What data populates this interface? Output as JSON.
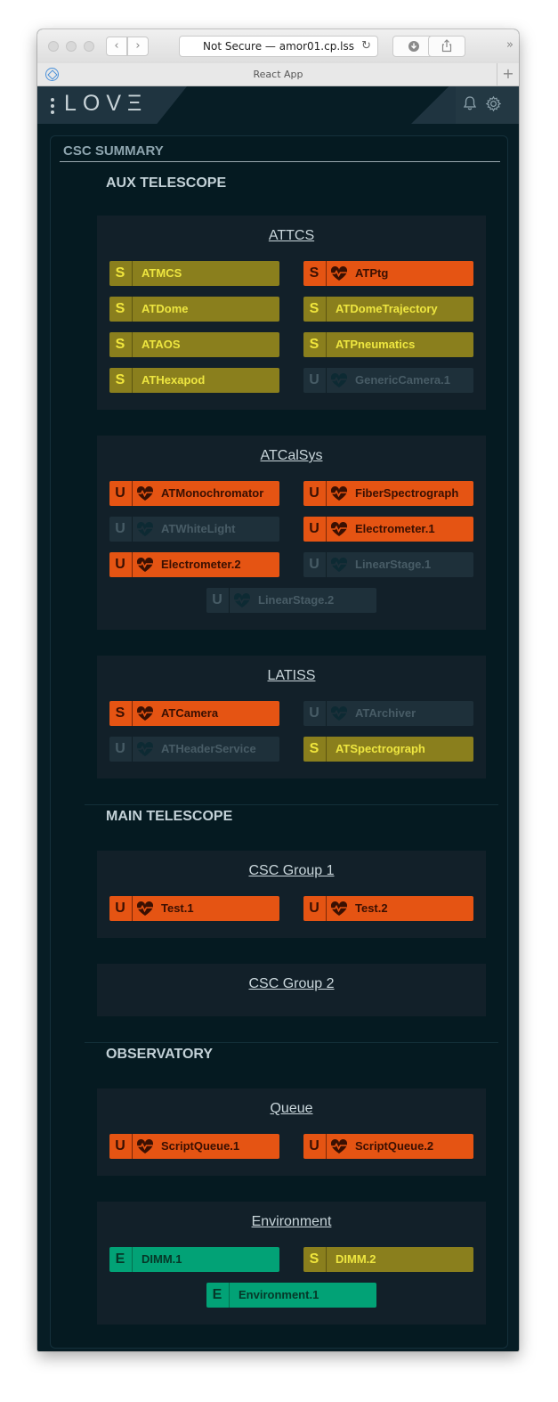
{
  "browser": {
    "address": "Not Secure — amor01.cp.lss",
    "tab_title": "React App",
    "back": "‹",
    "forward": "›",
    "reload": "↻",
    "more": "»",
    "plus": "+"
  },
  "app": {
    "logo": "LOVΞ",
    "notifications_icon": "bell-icon",
    "settings_icon": "gear-icon"
  },
  "summary": {
    "title": "CSC SUMMARY",
    "categories": [
      {
        "name": "AUX TELESCOPE",
        "groups": [
          {
            "name": "ATTCS",
            "cscs": [
              {
                "state": "S",
                "name": "ATMCS",
                "heartbeat": false,
                "status": "standby"
              },
              {
                "state": "S",
                "name": "ATPtg",
                "heartbeat": true,
                "status": "unknown-alert"
              },
              {
                "state": "S",
                "name": "ATDome",
                "heartbeat": false,
                "status": "standby"
              },
              {
                "state": "S",
                "name": "ATDomeTrajectory",
                "heartbeat": false,
                "status": "standby"
              },
              {
                "state": "S",
                "name": "ATAOS",
                "heartbeat": false,
                "status": "standby"
              },
              {
                "state": "S",
                "name": "ATPneumatics",
                "heartbeat": false,
                "status": "standby"
              },
              {
                "state": "S",
                "name": "ATHexapod",
                "heartbeat": false,
                "status": "standby"
              },
              {
                "state": "U",
                "name": "GenericCamera.1",
                "heartbeat": true,
                "status": "offline"
              }
            ]
          },
          {
            "name": "ATCalSys",
            "cscs": [
              {
                "state": "U",
                "name": "ATMonochromator",
                "heartbeat": true,
                "status": "unknown-alert"
              },
              {
                "state": "U",
                "name": "FiberSpectrograph",
                "heartbeat": true,
                "status": "unknown-alert"
              },
              {
                "state": "U",
                "name": "ATWhiteLight",
                "heartbeat": true,
                "status": "offline"
              },
              {
                "state": "U",
                "name": "Electrometer.1",
                "heartbeat": true,
                "status": "unknown-alert"
              },
              {
                "state": "U",
                "name": "Electrometer.2",
                "heartbeat": true,
                "status": "unknown-alert"
              },
              {
                "state": "U",
                "name": "LinearStage.1",
                "heartbeat": true,
                "status": "offline"
              },
              {
                "state": "U",
                "name": "LinearStage.2",
                "heartbeat": true,
                "status": "offline"
              }
            ]
          },
          {
            "name": "LATISS",
            "cscs": [
              {
                "state": "S",
                "name": "ATCamera",
                "heartbeat": true,
                "status": "unknown-alert"
              },
              {
                "state": "U",
                "name": "ATArchiver",
                "heartbeat": true,
                "status": "offline"
              },
              {
                "state": "U",
                "name": "ATHeaderService",
                "heartbeat": true,
                "status": "offline"
              },
              {
                "state": "S",
                "name": "ATSpectrograph",
                "heartbeat": false,
                "status": "standby"
              }
            ]
          }
        ]
      },
      {
        "name": "MAIN TELESCOPE",
        "groups": [
          {
            "name": "CSC Group 1",
            "cscs": [
              {
                "state": "U",
                "name": "Test.1",
                "heartbeat": true,
                "status": "unknown-alert"
              },
              {
                "state": "U",
                "name": "Test.2",
                "heartbeat": true,
                "status": "unknown-alert"
              }
            ]
          },
          {
            "name": "CSC Group 2",
            "cscs": []
          }
        ]
      },
      {
        "name": "OBSERVATORY",
        "groups": [
          {
            "name": "Queue",
            "cscs": [
              {
                "state": "U",
                "name": "ScriptQueue.1",
                "heartbeat": true,
                "status": "unknown-alert"
              },
              {
                "state": "U",
                "name": "ScriptQueue.2",
                "heartbeat": true,
                "status": "unknown-alert"
              }
            ]
          },
          {
            "name": "Environment",
            "cscs": [
              {
                "state": "E",
                "name": "DIMM.1",
                "heartbeat": false,
                "status": "enabled"
              },
              {
                "state": "S",
                "name": "DIMM.2",
                "heartbeat": false,
                "status": "standby"
              },
              {
                "state": "E",
                "name": "Environment.1",
                "heartbeat": false,
                "status": "enabled"
              }
            ]
          }
        ]
      }
    ]
  }
}
